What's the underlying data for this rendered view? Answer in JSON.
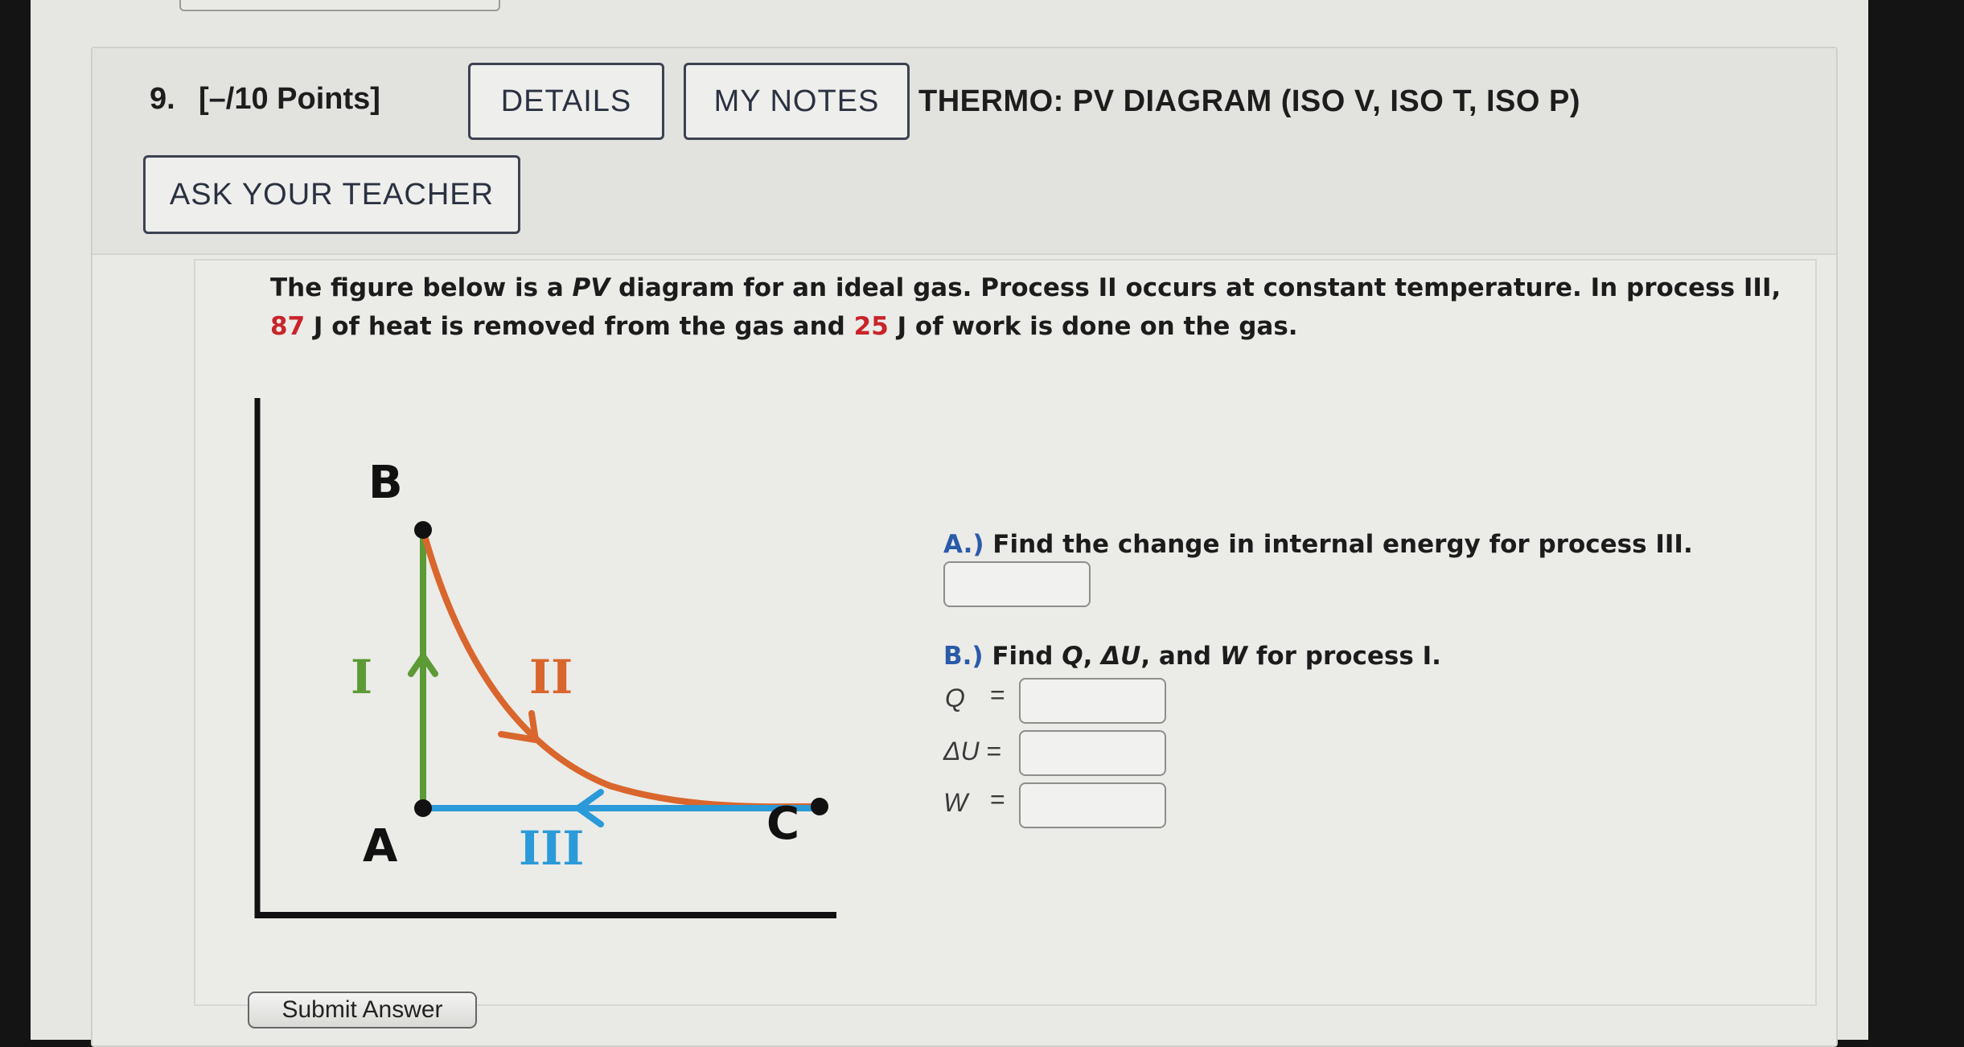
{
  "header": {
    "number": "9.",
    "points": "[–/10 Points]",
    "details_label": "DETAILS",
    "notes_label": "MY NOTES",
    "title": "THERMO: PV DIAGRAM (ISO V, ISO T, ISO P)",
    "ask_label": "ASK YOUR TEACHER"
  },
  "question": {
    "intro_1": "The figure below is a ",
    "intro_pv": "PV",
    "intro_2": " diagram for an ideal gas. Process II occurs at constant temperature. In process III, ",
    "heat_value": "87",
    "intro_3": " J of heat is removed from the gas and ",
    "work_value": "25",
    "intro_4": " J of work is done on the gas."
  },
  "diagram": {
    "points": {
      "a": "A",
      "b": "B",
      "c": "C"
    },
    "processes": {
      "i": "I",
      "ii": "II",
      "iii": "III"
    },
    "colors": {
      "process_i": "#5c9a35",
      "process_ii": "#d9662c",
      "process_iii": "#2b9ad8",
      "axes": "#111111"
    }
  },
  "parts": {
    "a": {
      "letter": "A.)",
      "text": " Find the change in internal energy for process III.",
      "answer": ""
    },
    "b": {
      "letter": "B.)",
      "text_1": " Find ",
      "q_sym": "Q",
      "text_2": ", ",
      "du_sym": "ΔU",
      "text_3": ", and ",
      "w_sym": "W",
      "text_4": " for process I.",
      "q_label": "Q",
      "du_label": "ΔU",
      "w_label": "W",
      "eq": "=",
      "q_answer": "",
      "du_answer": "",
      "w_answer": ""
    }
  },
  "footer": {
    "submit_label": "Submit Answer"
  }
}
